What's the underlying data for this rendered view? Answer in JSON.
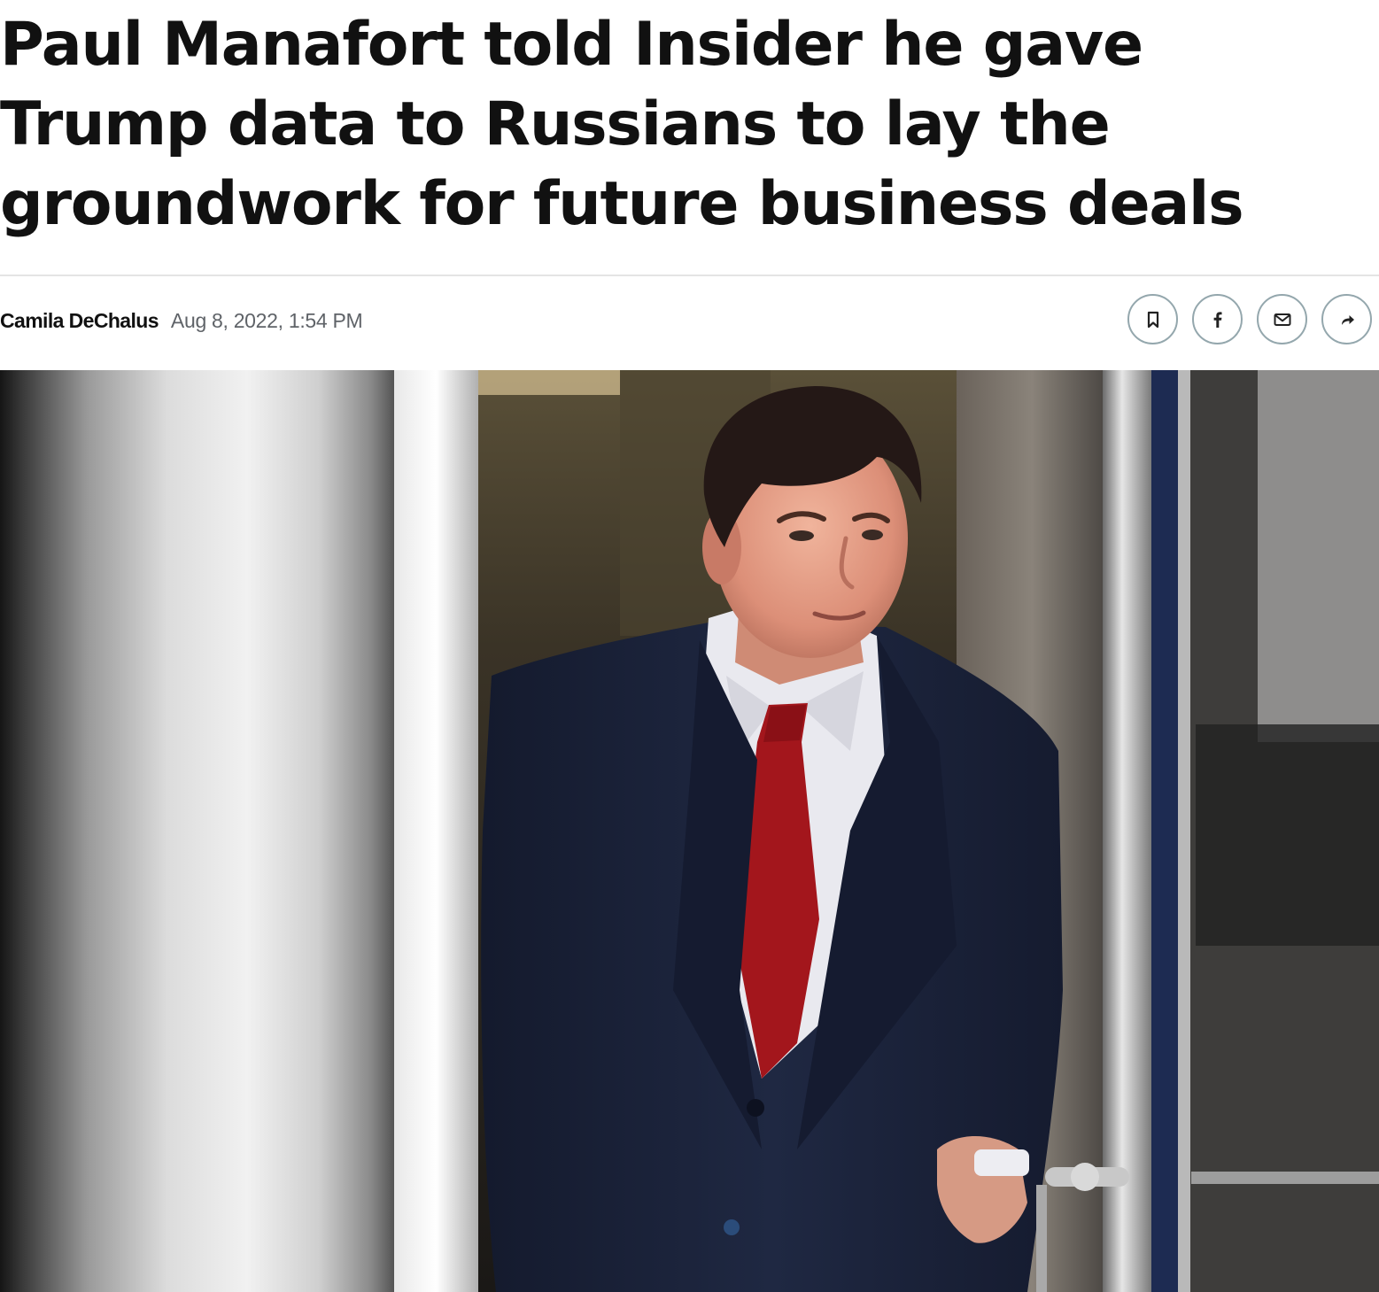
{
  "article": {
    "headline": "Paul Manafort told Insider he gave Trump data to Russians to lay the groundwork for future business deals",
    "author": "Camila DeChalus",
    "timestamp": "Aug 8, 2022, 1:54 PM"
  },
  "share_bar": {
    "buttons": [
      {
        "icon": "bookmark-icon"
      },
      {
        "icon": "facebook-icon"
      },
      {
        "icon": "email-icon"
      },
      {
        "icon": "share-arrow-icon"
      }
    ],
    "border_color": "#94a7ad"
  },
  "hero_image": {
    "subject": "photo-of-man-in-navy-suit-and-red-tie-exiting-glass-door"
  },
  "colors": {
    "headline": "#111111",
    "meta_text": "#5f6368",
    "suit": "#1b2138",
    "tie": "#a3161c"
  }
}
